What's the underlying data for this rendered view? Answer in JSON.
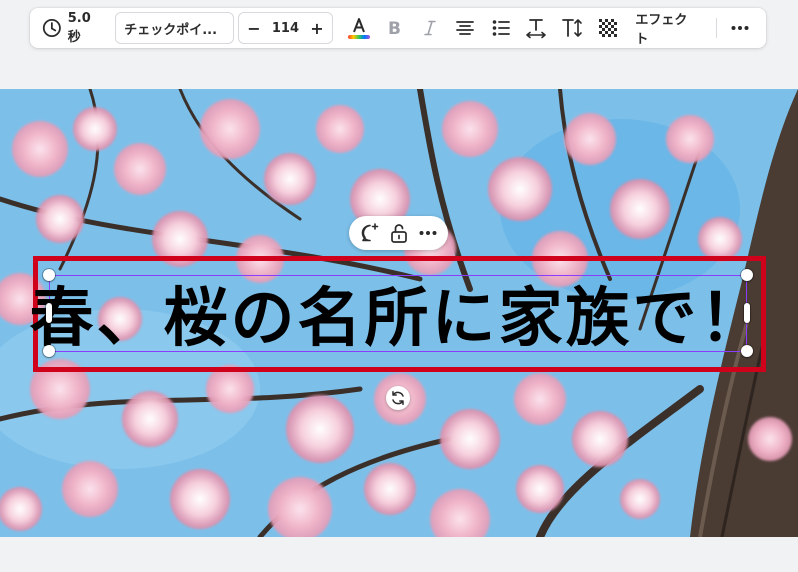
{
  "toolbar": {
    "duration": "5.0秒",
    "font_name": "チェックポイ...",
    "font_size": "114",
    "decrease": "−",
    "increase": "+",
    "effects_label": "エフェクト",
    "text_color": "#000000"
  },
  "canvas": {
    "headline": "春、桜の名所に家族で！",
    "highlight_color": "#d0021b",
    "selection_color": "#8b3dff"
  },
  "mini_toolbar": {
    "icons": [
      "add-comment-icon",
      "unlock-icon",
      "more-icon"
    ]
  }
}
